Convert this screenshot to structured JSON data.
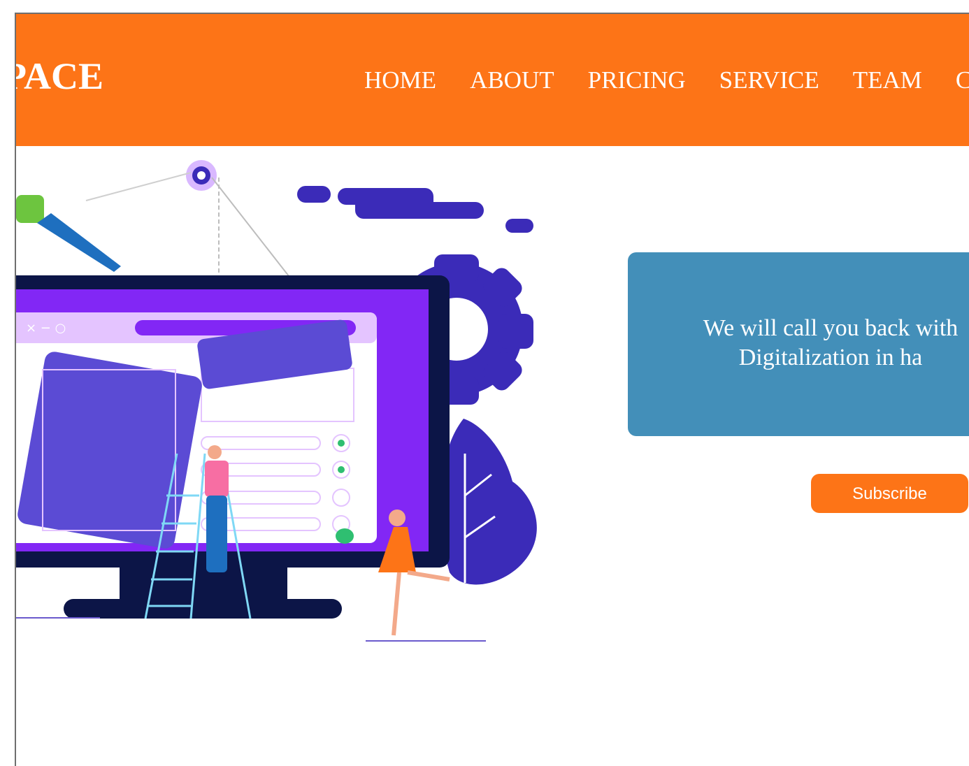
{
  "header": {
    "logo_text": "PACE",
    "nav": [
      {
        "label": "HOME"
      },
      {
        "label": "ABOUT"
      },
      {
        "label": "PRICING"
      },
      {
        "label": "SERVICE"
      },
      {
        "label": "TEAM"
      },
      {
        "label": "C"
      }
    ]
  },
  "hero": {
    "illustration": "digital-workspace-illustration",
    "callout_text": "We will call you back with\nDigitalization in ha",
    "subscribe_label": "Subscribe"
  },
  "colors": {
    "header_bg": "#fd7417",
    "callout_bg": "#438fb9",
    "button_bg": "#fd7417",
    "illustration_primary": "#3b2bb8",
    "illustration_accent": "#8227f5"
  }
}
